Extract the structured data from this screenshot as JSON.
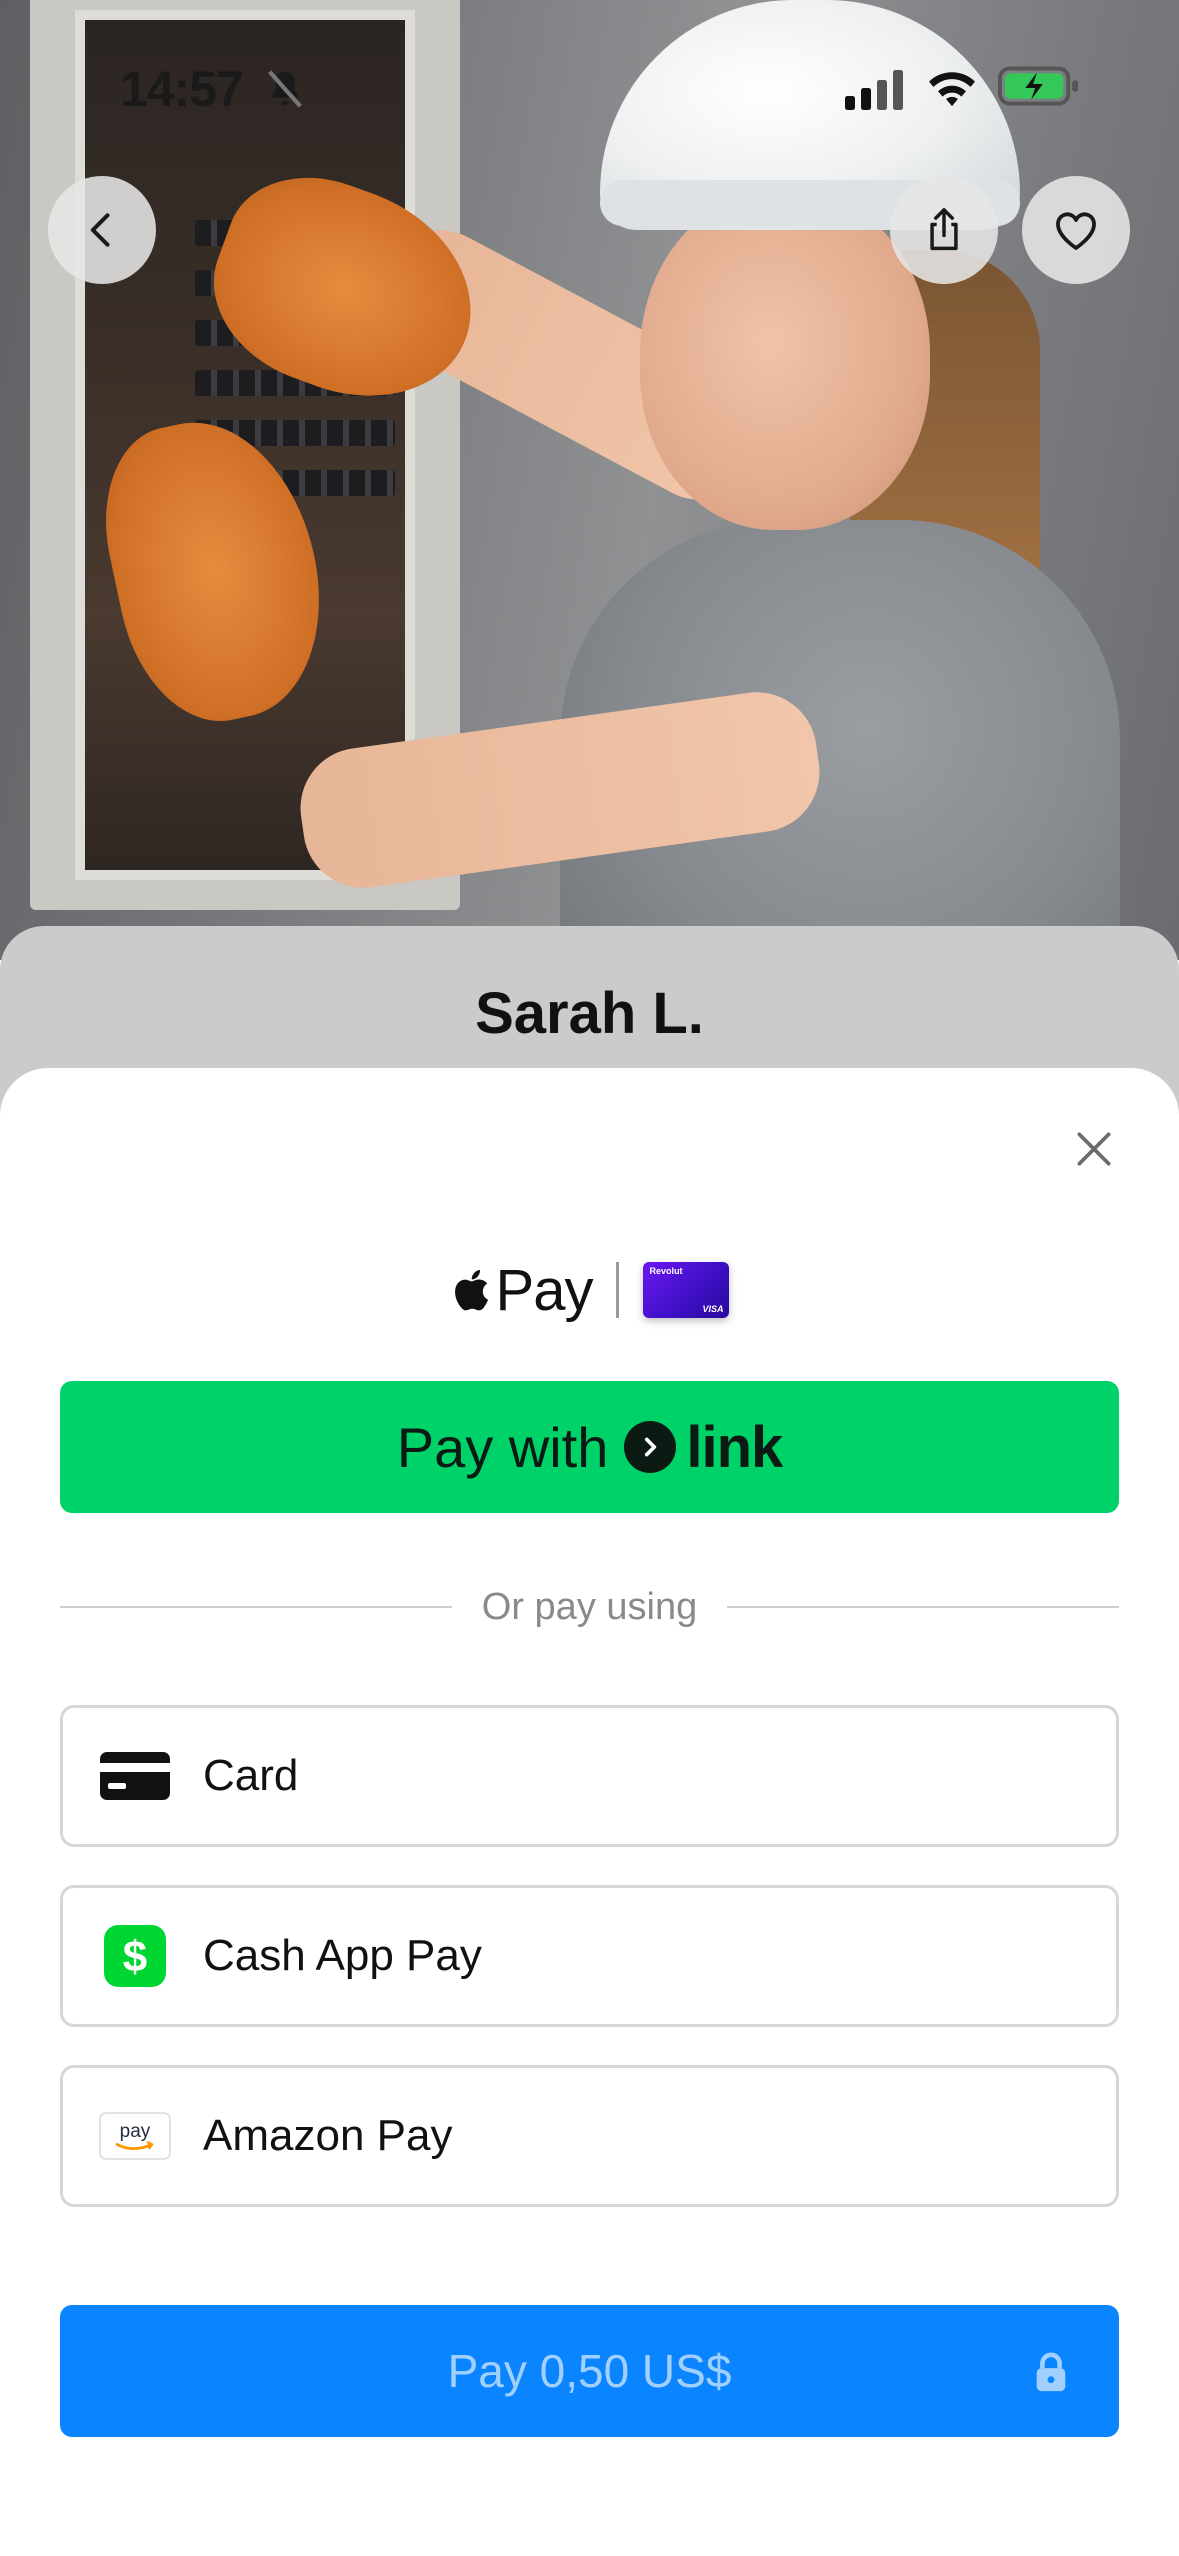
{
  "status_bar": {
    "time": "14:57",
    "icons": [
      "bell-slash-icon",
      "cellular-signal-icon",
      "wifi-icon",
      "battery-charging-icon"
    ]
  },
  "header": {
    "back_icon": "chevron-left-icon",
    "share_icon": "share-icon",
    "favorite_icon": "heart-icon"
  },
  "provider": {
    "name": "Sarah L."
  },
  "payment_sheet": {
    "close_icon": "close-icon",
    "apple_pay": {
      "label": "Pay",
      "icon": "apple-icon",
      "card_brand": "Revolut",
      "card_network": "VISA"
    },
    "link_button": {
      "label": "Pay with",
      "brand": "link"
    },
    "divider_text": "Or pay using",
    "methods": [
      {
        "label": "Card",
        "icon": "credit-card-icon"
      },
      {
        "label": "Cash App Pay",
        "icon": "cash-app-icon"
      },
      {
        "label": "Amazon Pay",
        "icon": "amazon-pay-icon",
        "icon_text": "pay"
      }
    ],
    "pay_button": {
      "label": "Pay 0,50 US$",
      "icon": "lock-icon"
    }
  },
  "colors": {
    "link_green": "#00d26a",
    "pay_blue": "#0a84ff",
    "cash_app_green": "#00d632",
    "revolut_purple": "#5b14e6"
  }
}
